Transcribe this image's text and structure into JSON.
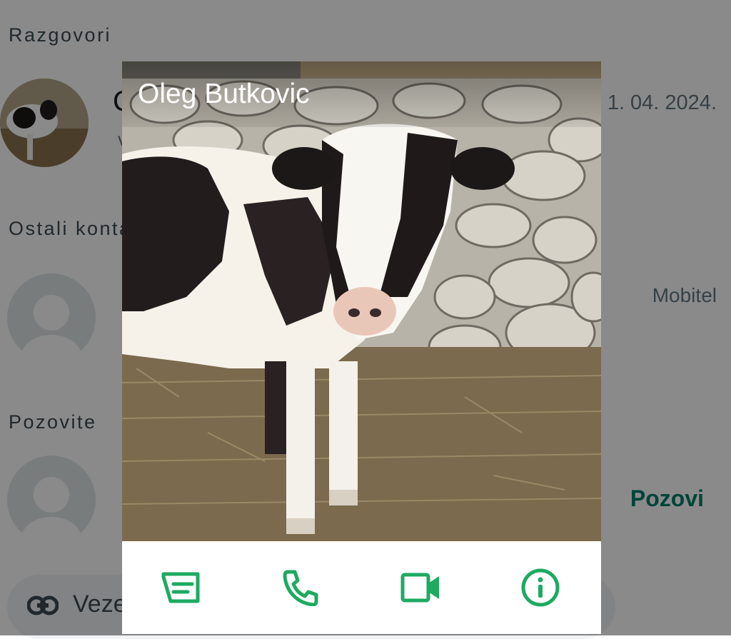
{
  "sections": {
    "conversations": "Razgovori",
    "other_contacts": "Ostali kontakti",
    "invite": "Pozovite"
  },
  "chat": {
    "name_partial": "C",
    "date": "1. 04. 2024.",
    "sub_partial": "v"
  },
  "contact_row": {
    "label": "Mobitel"
  },
  "invite_row": {
    "action": "Pozovi"
  },
  "link_pill": {
    "label": "Veze"
  },
  "popup": {
    "contact_name": "Oleg Butkovic",
    "actions": [
      "message-icon",
      "call-icon",
      "video-call-icon",
      "info-icon"
    ]
  },
  "colors": {
    "accent": "#1daa61",
    "dark_green": "#008069",
    "scrim": "rgba(0,0,0,0.46)"
  }
}
